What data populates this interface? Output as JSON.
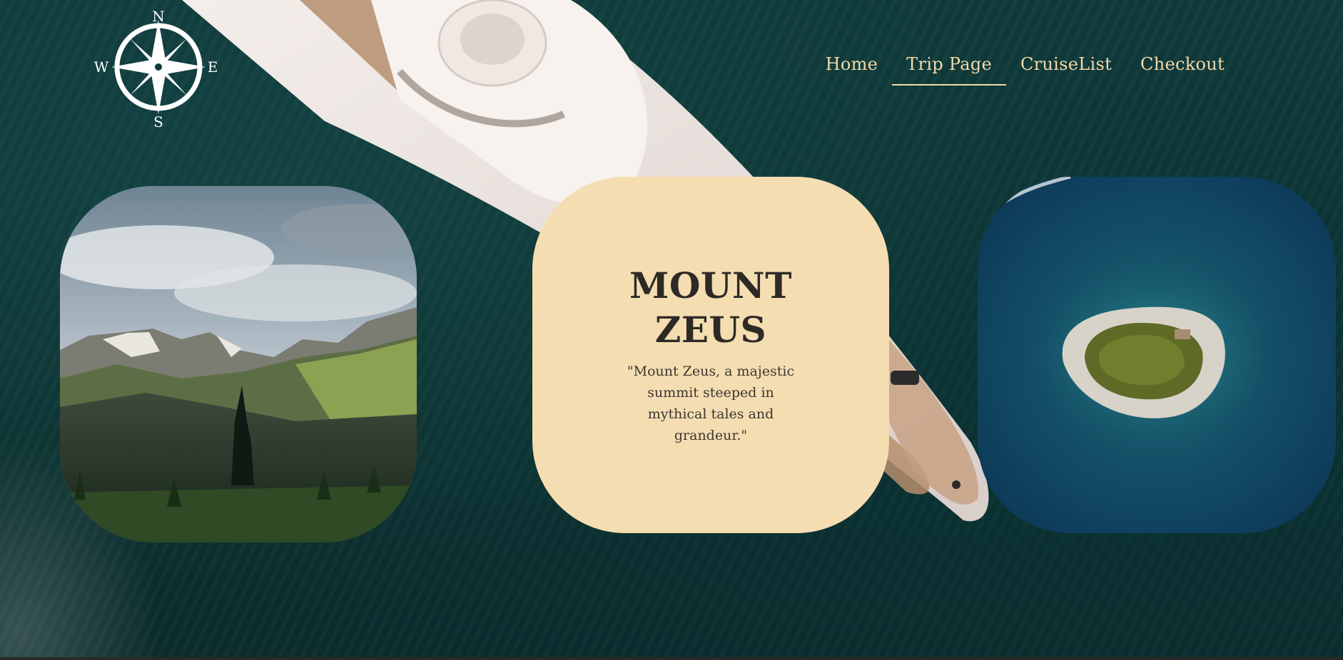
{
  "logo": {
    "compass_n": "N",
    "compass_s": "S",
    "compass_e": "E",
    "compass_w": "W",
    "icon": "compass-rose-icon"
  },
  "nav": {
    "items": [
      {
        "label": "Home"
      },
      {
        "label": "Trip Page",
        "active": true
      },
      {
        "label": "CruiseList"
      },
      {
        "label": "Checkout"
      }
    ]
  },
  "featured": {
    "title": "MOUNT ZEUS",
    "description": "\"Mount Zeus, a majestic summit steeped in mythical tales and grandeur.\""
  },
  "colors": {
    "accent": "#f3d9a8",
    "card_bg": "#f5ddb2",
    "title_text": "#2d2a26",
    "sea": "#10383a"
  }
}
